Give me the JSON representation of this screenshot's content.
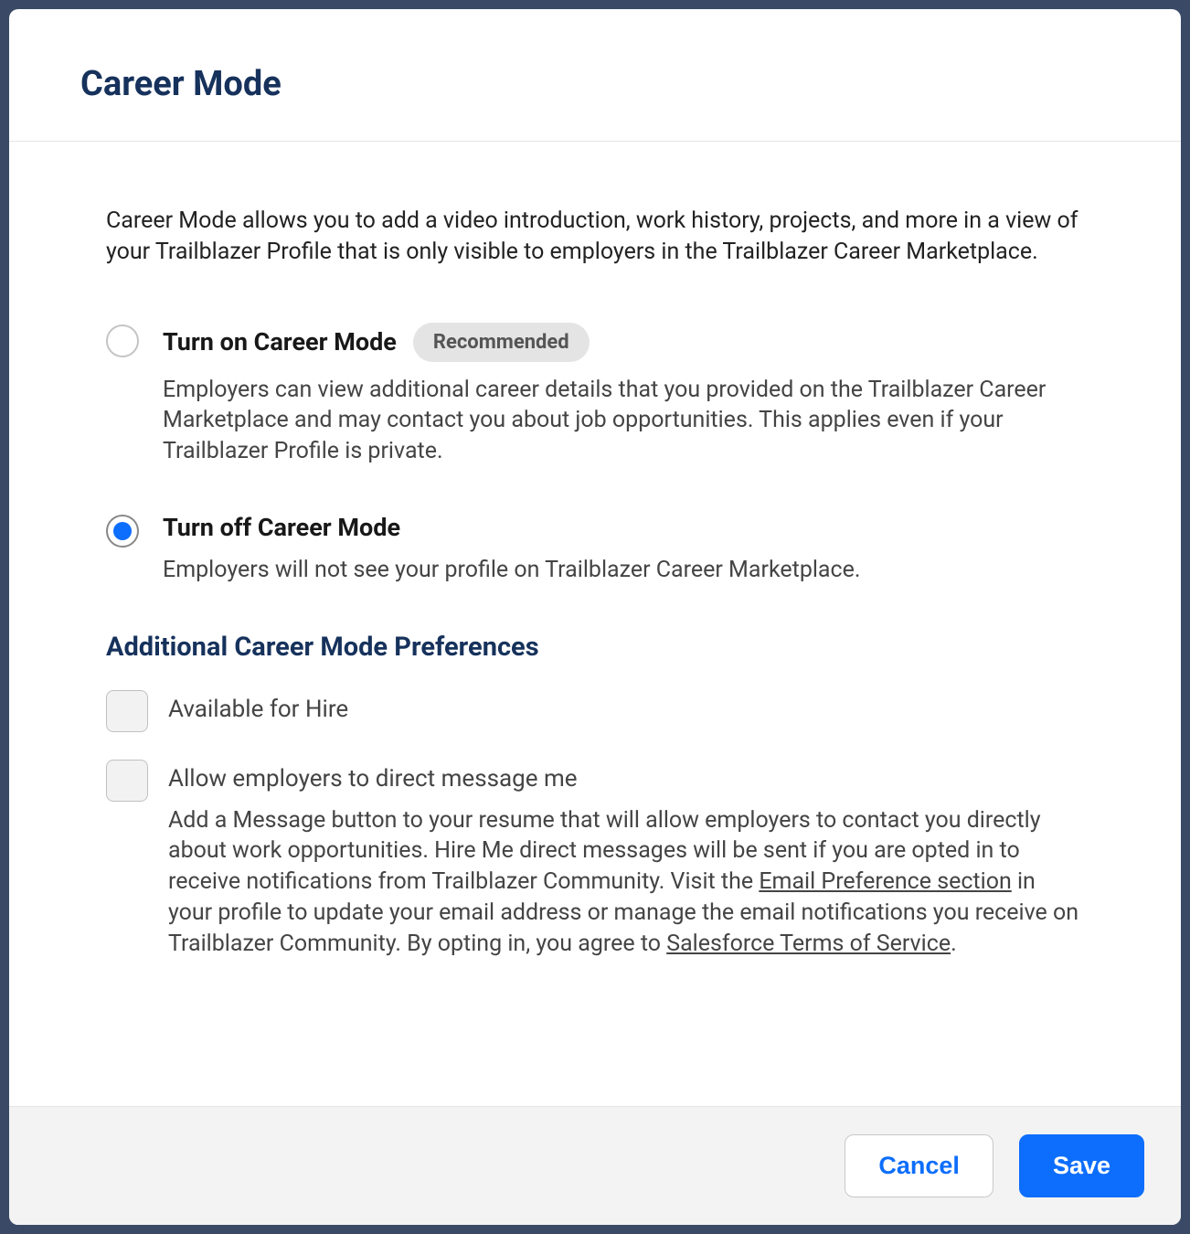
{
  "header": {
    "title": "Career Mode"
  },
  "intro": "Career Mode allows you to add a video introduction, work history, projects, and more in a view of your Trailblazer Profile that is only visible to employers in the Trailblazer Career Marketplace.",
  "radio_options": {
    "turn_on": {
      "label": "Turn on Career Mode",
      "badge": "Recommended",
      "description": "Employers can view additional career details that you provided on the Trailblazer Career Marketplace and may contact you about job opportunities. This applies even if your Trailblazer Profile is private.",
      "selected": false
    },
    "turn_off": {
      "label": "Turn off Career Mode",
      "description": "Employers will not see your profile on Trailblazer Career Marketplace.",
      "selected": true
    }
  },
  "preferences": {
    "title": "Additional Career Mode Preferences",
    "available_for_hire": {
      "label": "Available for Hire",
      "checked": false
    },
    "allow_dm": {
      "label": "Allow employers to direct message me",
      "checked": false,
      "desc_part1": "Add a Message button to your resume that will allow employers to contact you directly about work opportunities. Hire Me direct messages will be sent if you are opted in to receive notifications from Trailblazer Community. Visit the ",
      "link1": "Email Preference section",
      "desc_part2": " in your profile to update your email address or manage the email notifications you receive on Trailblazer Community. By opting in, you agree to ",
      "link2": "Salesforce Terms of Service",
      "desc_part3": "."
    }
  },
  "footer": {
    "cancel": "Cancel",
    "save": "Save"
  }
}
